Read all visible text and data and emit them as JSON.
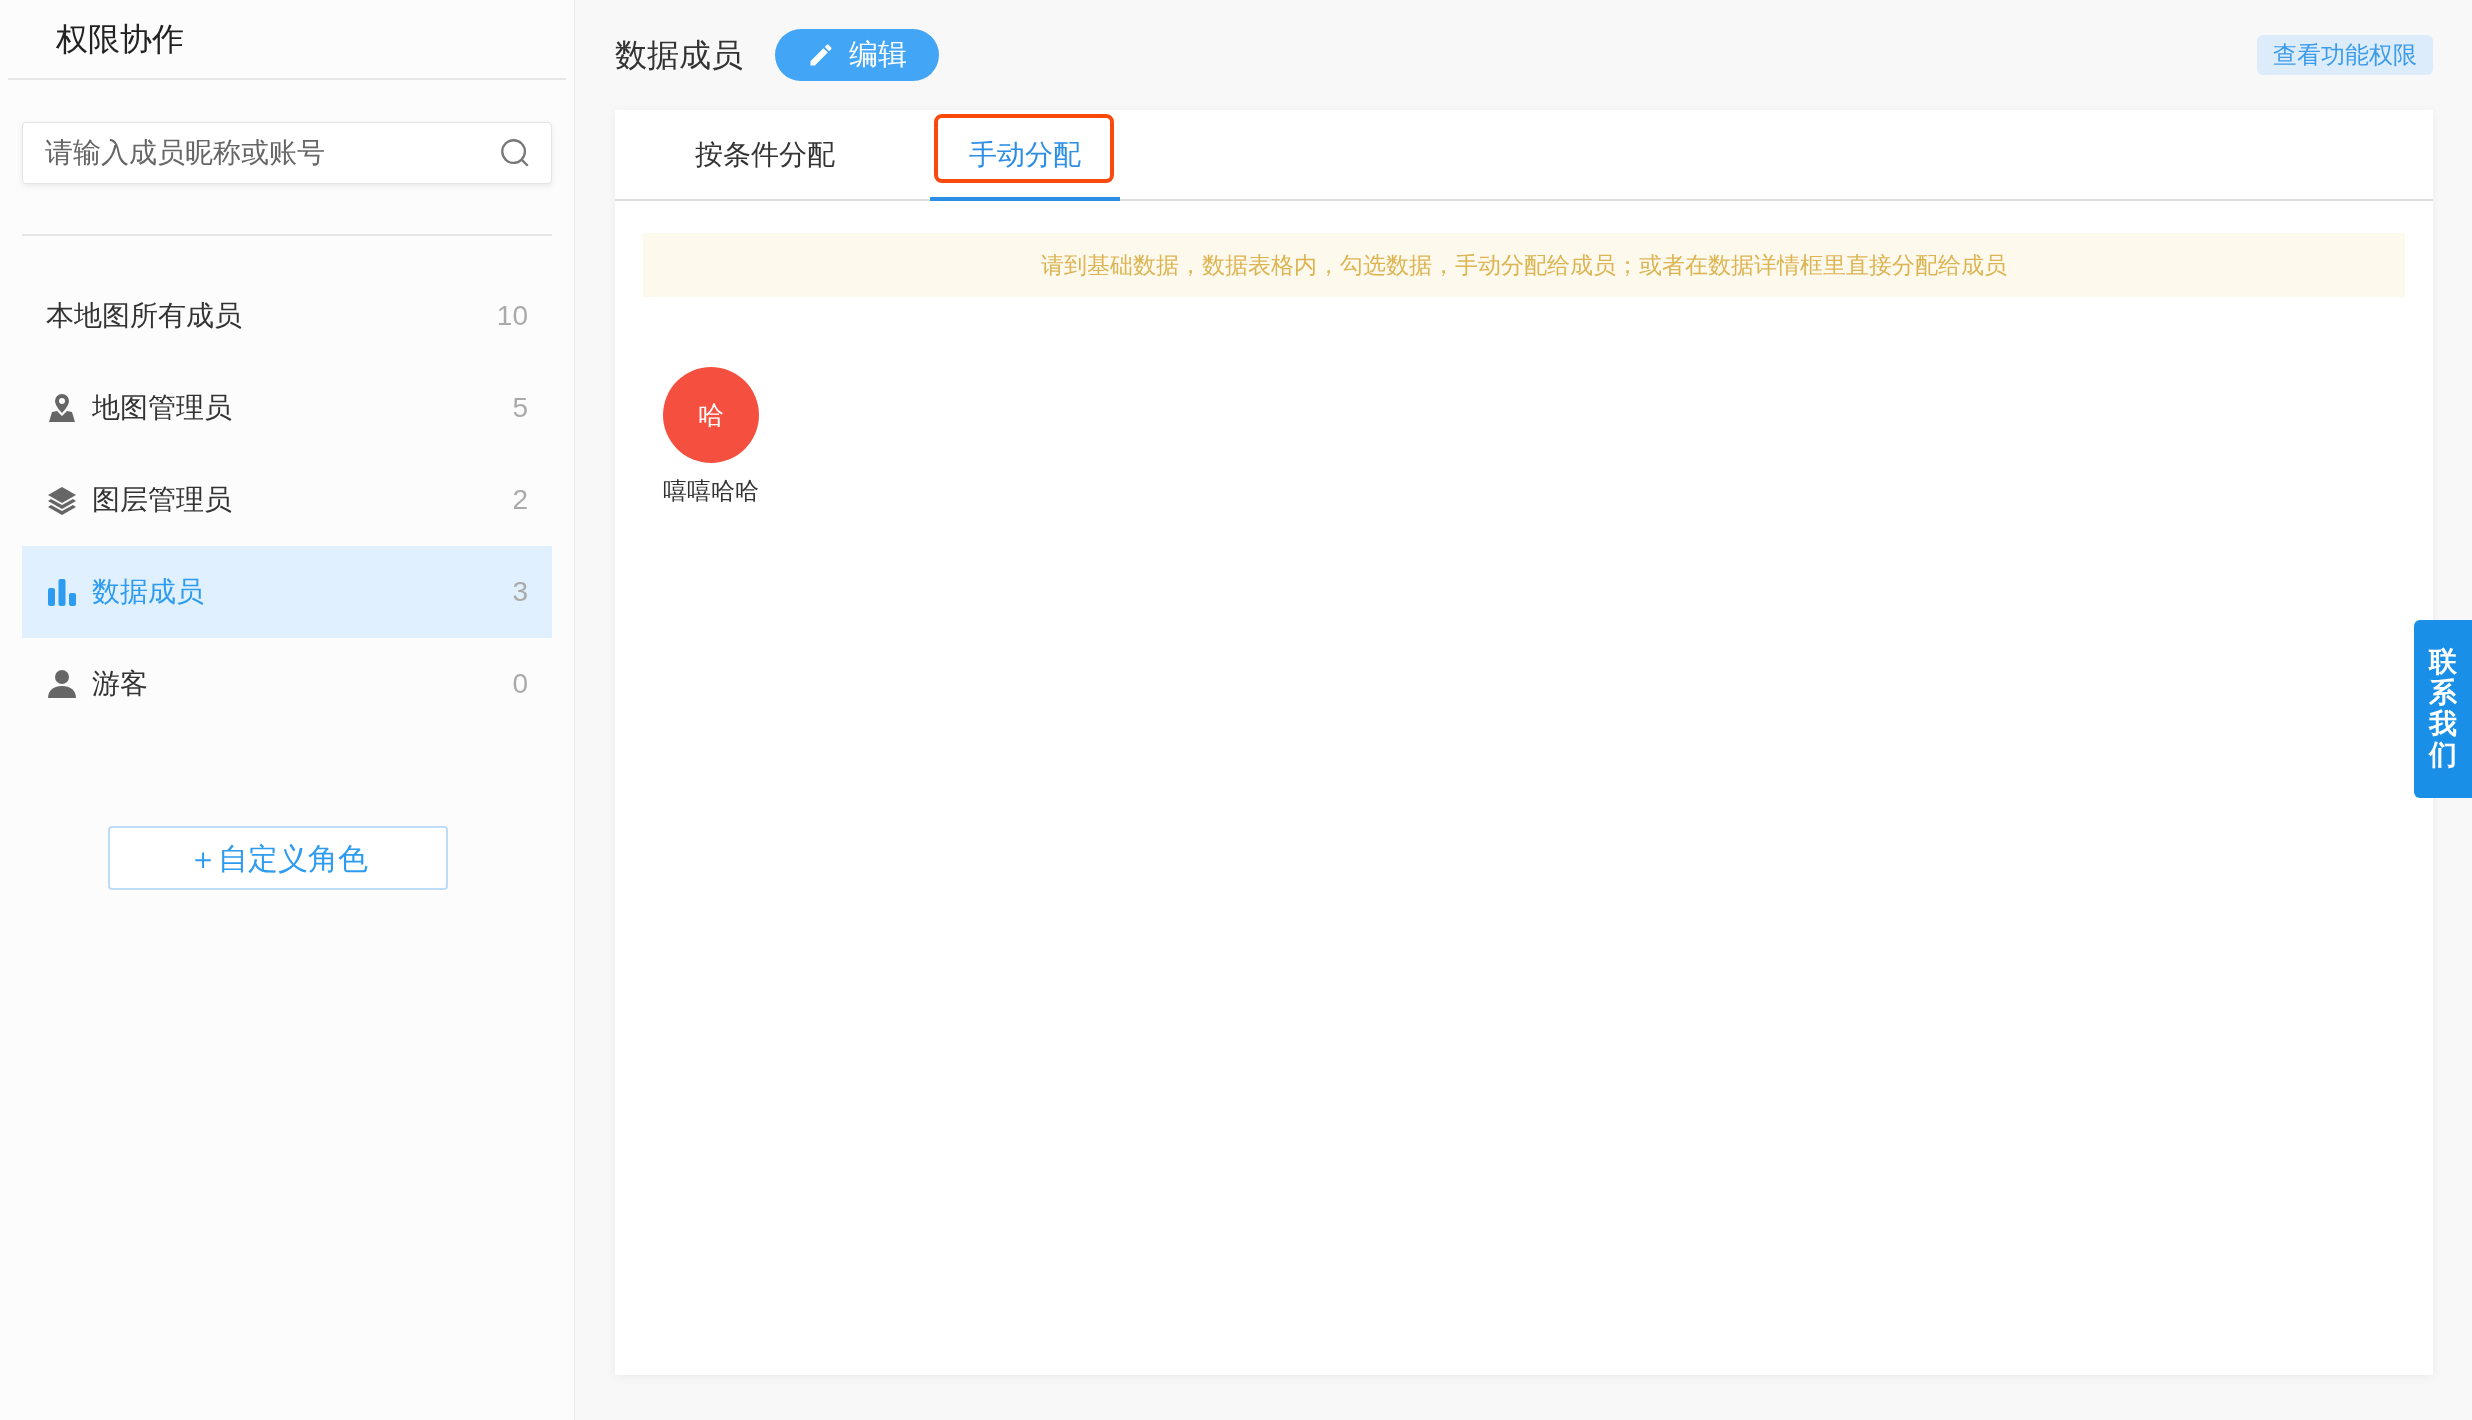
{
  "sidebar": {
    "title": "权限协作",
    "search": {
      "placeholder": "请输入成员昵称或账号"
    },
    "roles": [
      {
        "kind": "all",
        "label": "本地图所有成员",
        "count": "10",
        "selected": false
      },
      {
        "kind": "map_admin",
        "label": "地图管理员",
        "count": "5",
        "selected": false
      },
      {
        "kind": "layer_admin",
        "label": "图层管理员",
        "count": "2",
        "selected": false
      },
      {
        "kind": "data_member",
        "label": "数据成员",
        "count": "3",
        "selected": true
      },
      {
        "kind": "guest",
        "label": "游客",
        "count": "0",
        "selected": false
      }
    ],
    "add_role_button": "＋自定义角色"
  },
  "header": {
    "title": "数据成员",
    "edit_button": "编辑",
    "permissions_button": "查看功能权限"
  },
  "tabs": [
    {
      "label": "按条件分配",
      "selected": false,
      "highlighted": false
    },
    {
      "label": "手动分配",
      "selected": true,
      "highlighted": true
    }
  ],
  "notice": "请到基础数据，数据表格内，勾选数据，手动分配给成员；或者在数据详情框里直接分配给成员",
  "members": [
    {
      "initial": "哈",
      "name": "嘻嘻哈哈",
      "color": "#f5503f"
    }
  ],
  "contact_tab": "联系我们"
}
